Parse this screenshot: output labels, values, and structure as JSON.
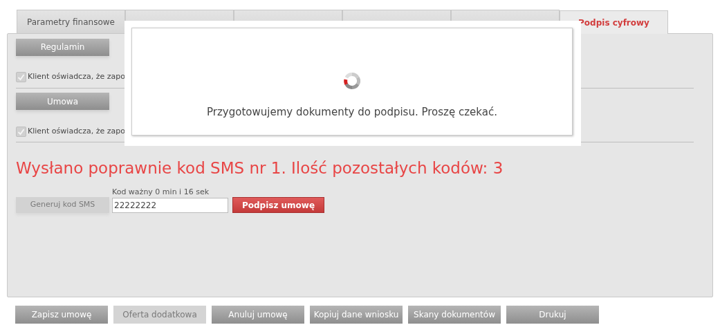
{
  "tabs": [
    {
      "label": "Parametry finansowe",
      "selected": false
    },
    {
      "selected": false
    },
    {
      "selected": false
    },
    {
      "selected": false
    },
    {
      "selected": false
    },
    {
      "label": "Podpis cyfrowy",
      "selected": true
    }
  ],
  "documents": [
    {
      "button": "Regulamin",
      "consent": "Klient oświadcza, że zapo",
      "checked": true
    },
    {
      "button": "Umowa",
      "consent": "Klient oświadcza, że zapo",
      "checked": true
    }
  ],
  "sms_status": "Wysłano poprawnie kod SMS nr 1. Ilość pozostałych kodów: 3",
  "sms": {
    "generate_button": {
      "label": "Generuj kod SMS",
      "disabled": true
    },
    "code_label": "Kod ważny 0 min i 16 sek",
    "code_value": "22222222",
    "sign_button": "Podpisz umowę"
  },
  "actions": [
    {
      "label": "Zapisz umowę",
      "disabled": false
    },
    {
      "label": "Oferta dodatkowa",
      "disabled": true
    },
    {
      "label": "Anuluj umowę",
      "disabled": false
    },
    {
      "label": "Kopiuj dane wniosku",
      "disabled": false
    },
    {
      "label": "Skany dokumentów",
      "disabled": false
    },
    {
      "label": "Drukuj",
      "disabled": false
    }
  ],
  "loading_dialog": {
    "message": "Przygotowujemy dokumenty do podpisu. Proszę czekać."
  }
}
